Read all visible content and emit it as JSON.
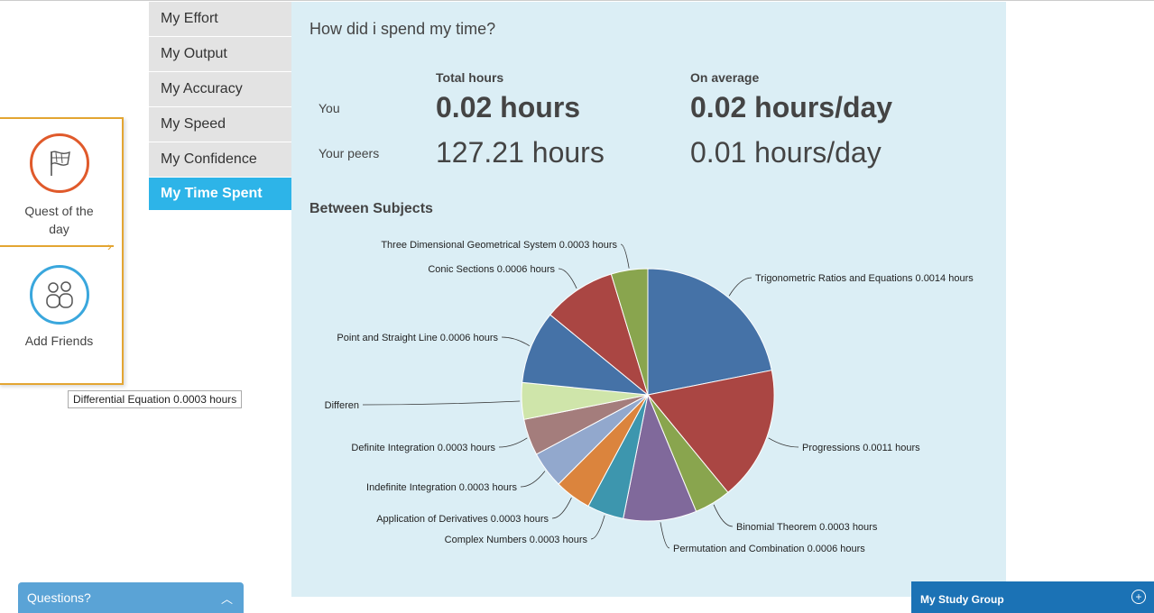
{
  "quest": {
    "items": [
      {
        "label": "Quest of the day",
        "icon": "flag-icon"
      },
      {
        "label": "Add Friends",
        "icon": "friends-icon"
      }
    ]
  },
  "menu": {
    "items": [
      {
        "label": "My Effort",
        "active": false
      },
      {
        "label": "My Output",
        "active": false
      },
      {
        "label": "My Accuracy",
        "active": false
      },
      {
        "label": "My Speed",
        "active": false
      },
      {
        "label": "My Confidence",
        "active": false
      },
      {
        "label": "My Time Spent",
        "active": true
      }
    ]
  },
  "panel": {
    "title": "How did i spend my time?",
    "col_total": "Total hours",
    "col_average": "On average",
    "rows": [
      {
        "label": "You",
        "total": "0.02 hours",
        "average": "0.02 hours/day"
      },
      {
        "label": "Your peers",
        "total": "127.21 hours",
        "average": "0.01 hours/day"
      }
    ],
    "section_title": "Between Subjects",
    "tooltip": "Differential Equation 0.0003 hours"
  },
  "chart_data": {
    "type": "pie",
    "title": "Between Subjects",
    "unit": "hours",
    "slices": [
      {
        "label": "Trigonometric Ratios and Equations 0.0014 hours",
        "value": 0.0014,
        "color": "#4572a7"
      },
      {
        "label": "Progressions 0.0011 hours",
        "value": 0.0011,
        "color": "#aa4643"
      },
      {
        "label": "Binomial Theorem 0.0003 hours",
        "value": 0.0003,
        "color": "#89a54e"
      },
      {
        "label": "Permutation and Combination 0.0006 hours",
        "value": 0.0006,
        "color": "#80699b"
      },
      {
        "label": "Complex Numbers 0.0003 hours",
        "value": 0.0003,
        "color": "#3d96ae"
      },
      {
        "label": "Application of Derivatives 0.0003 hours",
        "value": 0.0003,
        "color": "#db843d"
      },
      {
        "label": "Indefinite Integration 0.0003 hours",
        "value": 0.0003,
        "color": "#92a8cd"
      },
      {
        "label": "Definite Integration 0.0003 hours",
        "value": 0.0003,
        "color": "#a47d7c"
      },
      {
        "label": "Differen",
        "value": 0.0003,
        "color": "#cfe5aa"
      },
      {
        "label": "Point and Straight Line 0.0006 hours",
        "value": 0.0006,
        "color": "#4572a7"
      },
      {
        "label": "Conic Sections 0.0006 hours",
        "value": 0.0006,
        "color": "#aa4643"
      },
      {
        "label": "Three Dimensional Geometrical System 0.0003 hours",
        "value": 0.0003,
        "color": "#89a54e"
      }
    ]
  },
  "bottom": {
    "questions_label": "Questions?",
    "study_group_label": "My Study Group"
  },
  "colors": {
    "active_menu": "#2db4e8",
    "panel_bg": "#dbeef5",
    "quest_border": "#e3a532"
  }
}
